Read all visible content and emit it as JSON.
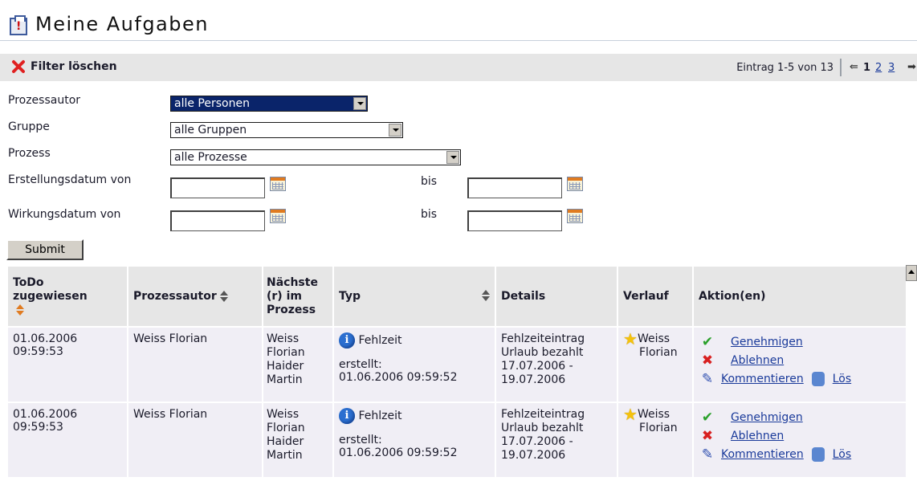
{
  "page": {
    "title": "Meine Aufgaben"
  },
  "toolbar": {
    "filter_clear": "Filter löschen",
    "entry_info": "Eintrag 1-5 von 13",
    "pages": [
      "1",
      "2",
      "3"
    ]
  },
  "filters": {
    "prozessautor": {
      "label": "Prozessautor",
      "value": "alle Personen"
    },
    "gruppe": {
      "label": "Gruppe",
      "value": "alle Gruppen"
    },
    "prozess": {
      "label": "Prozess",
      "value": "alle Prozesse"
    },
    "erstellungsdatum": {
      "label": "Erstellungsdatum von",
      "to_label": "bis",
      "from": "",
      "to": ""
    },
    "wirkungsdatum": {
      "label": "Wirkungsdatum von",
      "to_label": "bis",
      "from": "",
      "to": ""
    },
    "submit": "Submit"
  },
  "table": {
    "headers": {
      "todo": "ToDo zugewiesen",
      "autor": "Prozessautor",
      "naechste": "Nächste (r) im Prozess",
      "typ": "Typ",
      "details": "Details",
      "verlauf": "Verlauf",
      "aktion": "Aktion(en)"
    },
    "rows": [
      {
        "date": "01.06.2006",
        "time": "09:59:53",
        "autor": "Weiss Florian",
        "next": [
          "Weiss",
          "Florian",
          "Haider",
          "Martin"
        ],
        "typ": "Fehlzeit",
        "created_label": "erstellt:",
        "created": "01.06.2006 09:59:52",
        "details": [
          "Fehlzeiteintrag",
          "Urlaub bezahlt",
          "17.07.2006 -",
          "19.07.2006"
        ],
        "verlauf": [
          "Weiss",
          "Florian"
        ],
        "actions": {
          "approve": "Genehmigen",
          "reject": "Ablehnen",
          "comment": "Kommentieren",
          "delete": "Lös"
        }
      },
      {
        "date": "01.06.2006",
        "time": "09:59:53",
        "autor": "Weiss Florian",
        "next": [
          "Weiss",
          "Florian",
          "Haider",
          "Martin"
        ],
        "typ": "Fehlzeit",
        "created_label": "erstellt:",
        "created": "01.06.2006 09:59:52",
        "details": [
          "Fehlzeiteintrag",
          "Urlaub bezahlt",
          "17.07.2006 -",
          "19.07.2006"
        ],
        "verlauf": [
          "Weiss",
          "Florian"
        ],
        "actions": {
          "approve": "Genehmigen",
          "reject": "Ablehnen",
          "comment": "Kommentieren",
          "delete": "Lös"
        }
      }
    ]
  },
  "icons": {
    "title": "task-icon",
    "filter_clear": "x-icon",
    "prev": "arrow-left-icon",
    "next": "arrow-right-icon",
    "calendar": "calendar-icon",
    "info": "info-icon",
    "history": "star-icon",
    "approve": "checkmark-icon",
    "reject": "x-icon",
    "comment": "paperclip-icon",
    "delete": "database-icon"
  },
  "colors": {
    "link": "#1a3a9a",
    "header_bg": "#e6e6e6",
    "row_bg": "#f0eef5",
    "selected": "#0a246a"
  }
}
